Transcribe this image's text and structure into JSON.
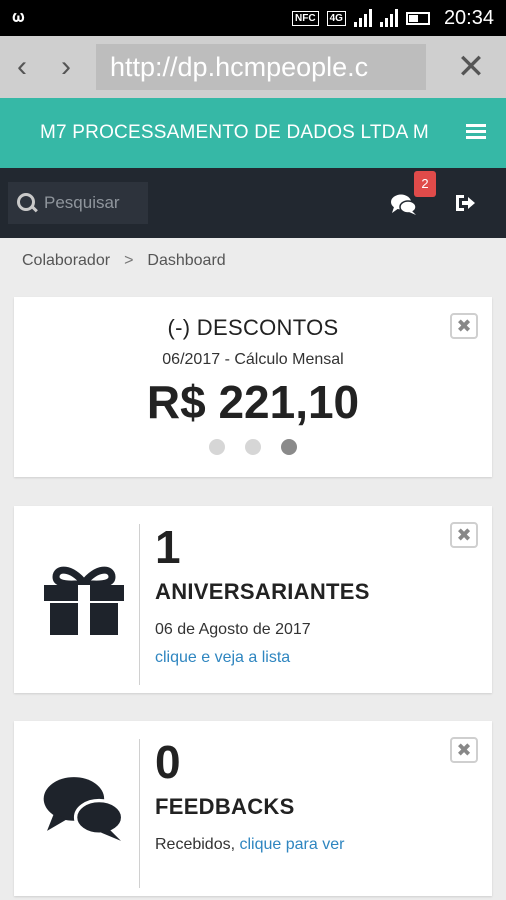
{
  "statusbar": {
    "left_icon": "voicemail-icon",
    "nfc_label": "NFC",
    "network_label": "4G",
    "time": "20:34"
  },
  "browser": {
    "url": "http://dp.hcmpeople.c",
    "back_icon": "chevron-left-icon",
    "forward_icon": "chevron-right-icon",
    "close_icon": "close-icon"
  },
  "header": {
    "company_name": "M7 PROCESSAMENTO DE DADOS LTDA M",
    "brand_color": "#36b8a6"
  },
  "toolbar": {
    "search_placeholder": "Pesquisar",
    "notifications_count": "2",
    "chat_icon": "chat-bubbles-icon",
    "logout_icon": "logout-icon"
  },
  "breadcrumb": {
    "items": [
      "Colaborador",
      "Dashboard"
    ],
    "separator": ">"
  },
  "cards": {
    "discounts": {
      "title": "(-) DESCONTOS",
      "subtitle": "06/2017 - Cálculo Mensal",
      "value": "R$ 221,10",
      "carousel_total": 3,
      "carousel_active": 3
    },
    "birthdays": {
      "count": "1",
      "label": "ANIVERSARIANTES",
      "date": "06 de Agosto de 2017",
      "link": "clique e veja a lista",
      "icon": "gift-icon"
    },
    "feedbacks": {
      "count": "0",
      "label": "FEEDBACKS",
      "received_text": "Recebidos, ",
      "link": "clique para ver",
      "icon": "chat-bubbles-icon"
    },
    "close_label": "✖"
  }
}
